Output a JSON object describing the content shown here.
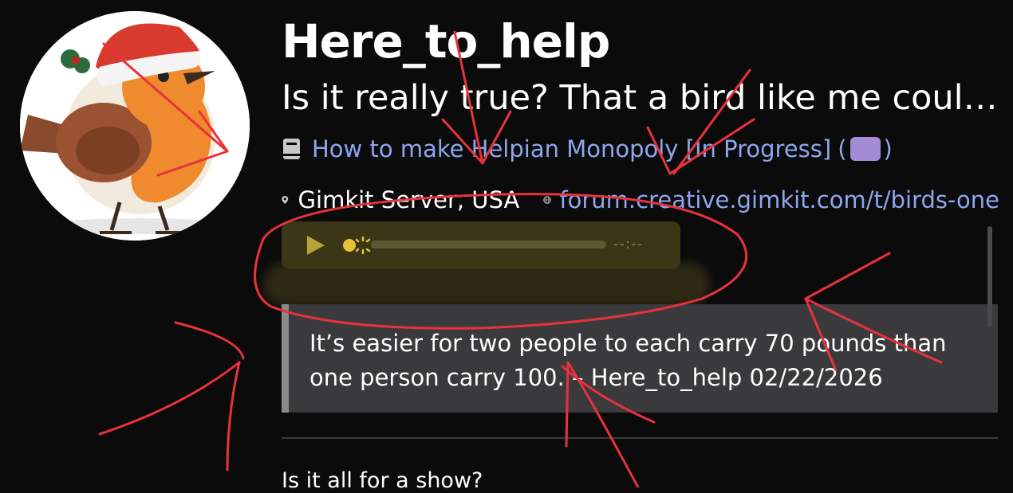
{
  "profile": {
    "username": "Here_to_help",
    "bio": "Is it really true? That a bird like me could…",
    "avatar_alt": "robin-in-santa-hat"
  },
  "featured_topic": {
    "icon": "book-icon",
    "title": "How to make Helpian Monopoly [In Progress]",
    "open_paren": "(",
    "close_paren": ")"
  },
  "details": {
    "location_icon": "pin-icon",
    "location": "Gimkit Server, USA",
    "website_icon": "globe-icon",
    "website": "forum.creative.gimkit.com/t/birds-one"
  },
  "audio_player": {
    "play_icon": "play-icon",
    "loading_icon": "spinner-icon",
    "time": "--:--",
    "progress": 0
  },
  "quote": {
    "text": "It’s easier for two people to each carry 70 pounds than one person carry 100. – Here_to_help 02/22/2026"
  },
  "next_post": {
    "title": "Is it all for a show?"
  },
  "colors": {
    "background": "#0b0b0c",
    "link": "#8ea6ee",
    "annotation": "#e8323c",
    "quote_bg": "#3a3a3c"
  }
}
